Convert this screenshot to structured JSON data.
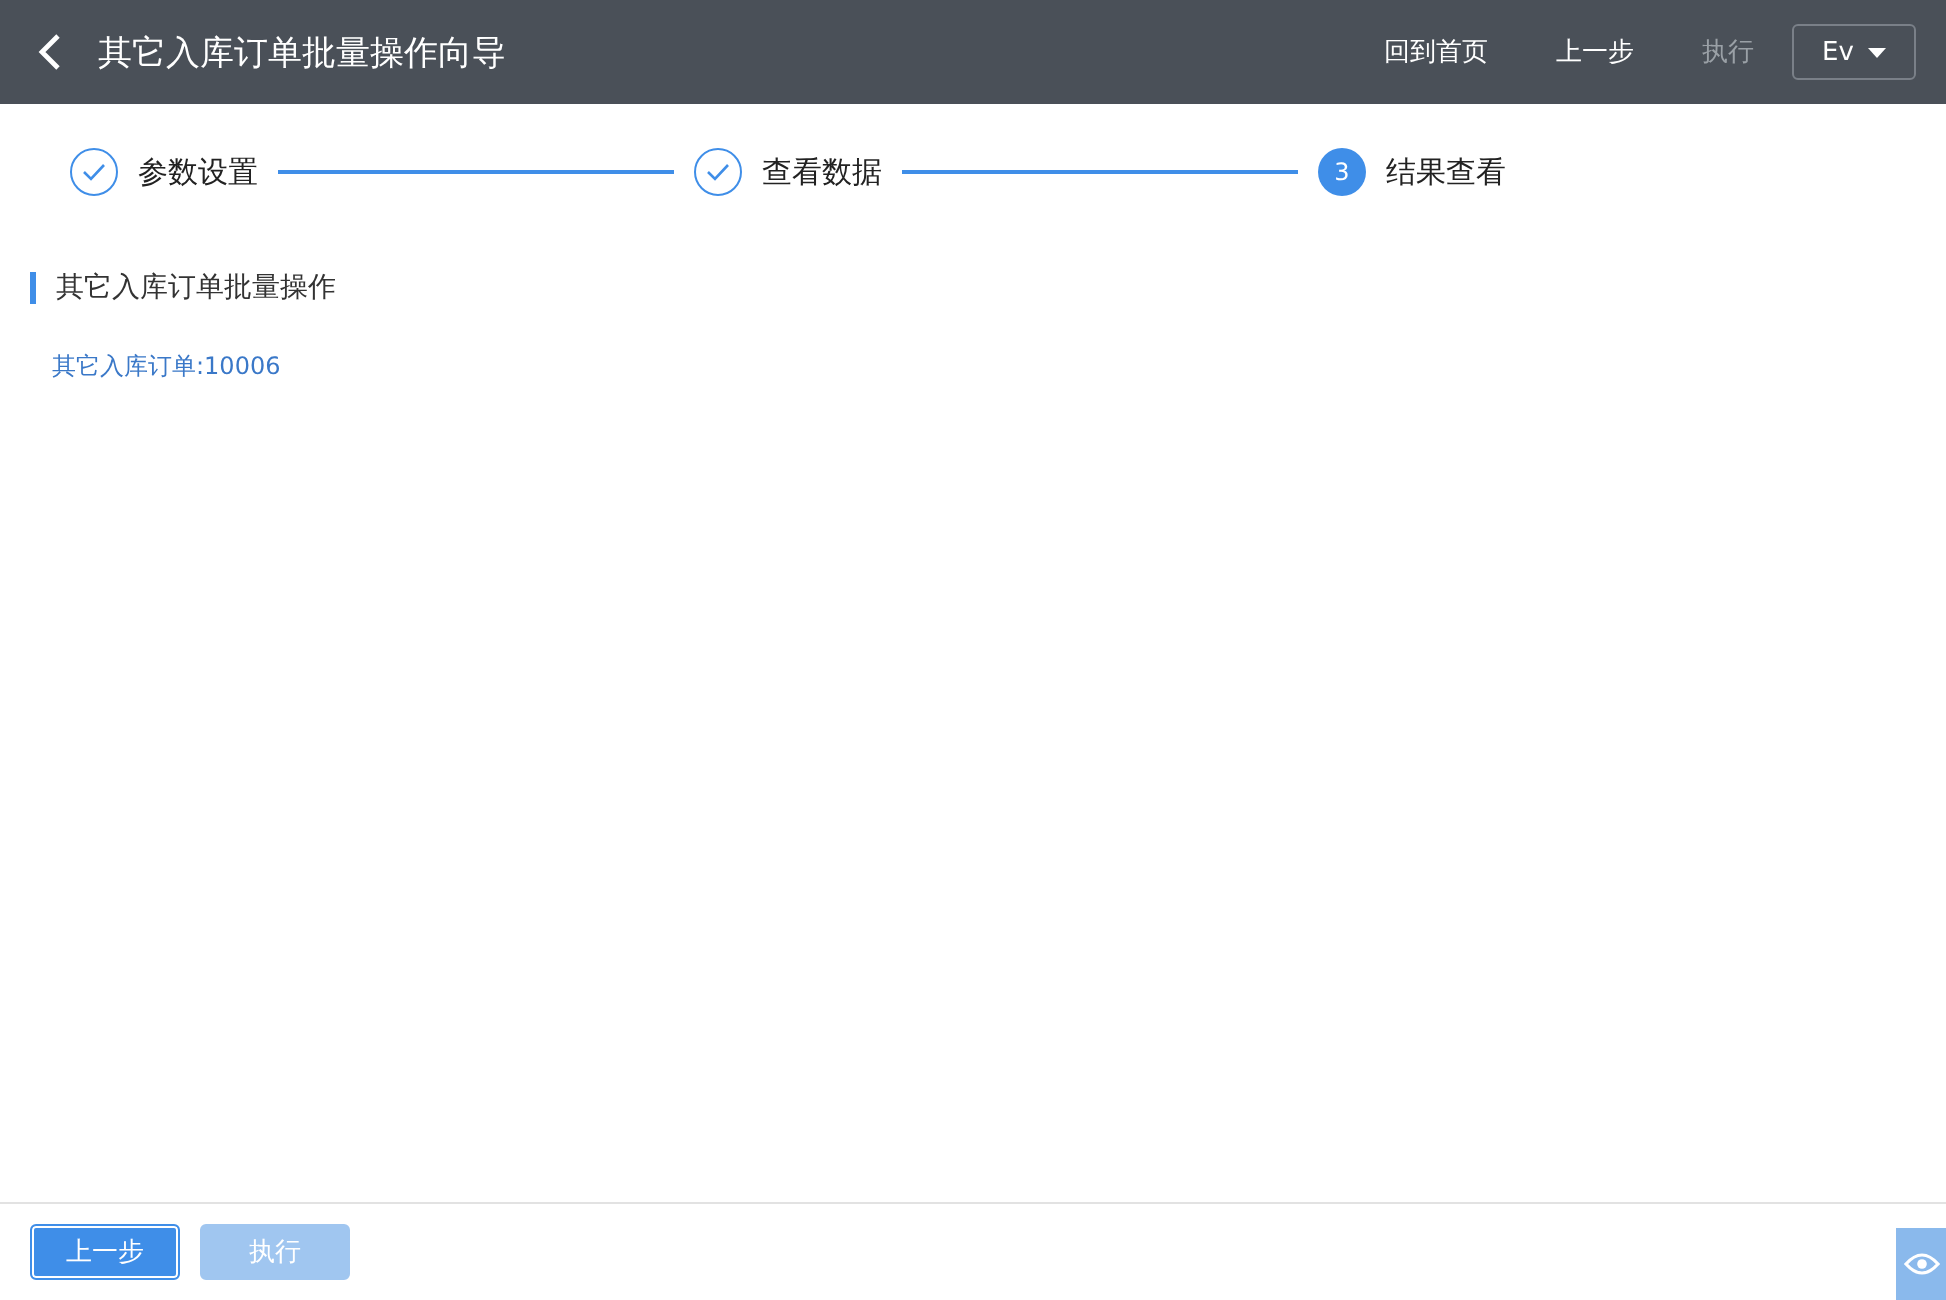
{
  "header": {
    "title": "其它入库订单批量操作向导",
    "actions": [
      {
        "label": "回到首页",
        "disabled": false
      },
      {
        "label": "上一步",
        "disabled": false
      },
      {
        "label": "执行",
        "disabled": true
      }
    ],
    "user_menu": "Ev"
  },
  "steps": [
    {
      "label": "参数设置",
      "kind": "done"
    },
    {
      "label": "查看数据",
      "kind": "done"
    },
    {
      "label": "结果查看",
      "kind": "current",
      "number": "3"
    }
  ],
  "section": {
    "title": "其它入库订单批量操作",
    "result": "其它入库订单:10006"
  },
  "footer": {
    "buttons": [
      {
        "label": "上一步",
        "disabled": false
      },
      {
        "label": "执行",
        "disabled": true
      }
    ]
  }
}
